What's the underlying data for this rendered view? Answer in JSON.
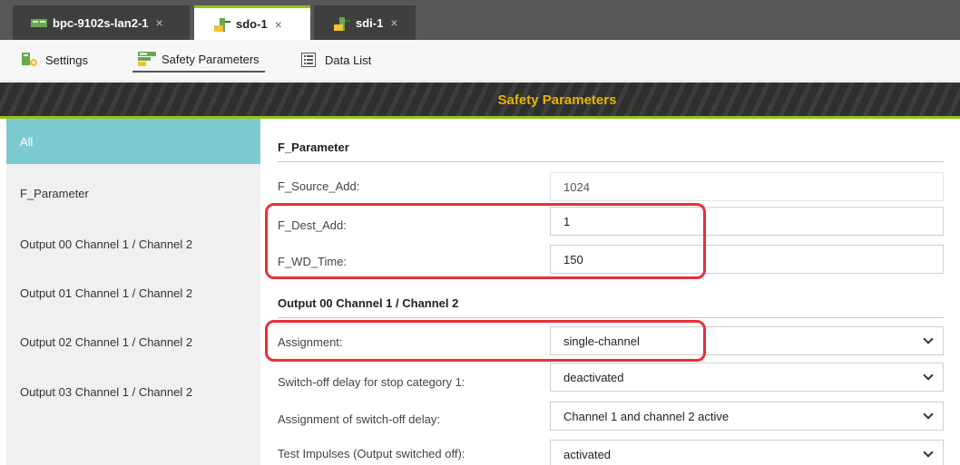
{
  "tabs": [
    {
      "label": "bpc-9102s-lan2-1",
      "close": "×",
      "icon": "device-icon",
      "active": false
    },
    {
      "label": "sdo-1",
      "close": "×",
      "icon": "module-icon",
      "active": true
    },
    {
      "label": "sdi-1",
      "close": "×",
      "icon": "module-icon",
      "active": false
    }
  ],
  "toolbar": {
    "settings_label": "Settings",
    "safety_label": "Safety Parameters",
    "datalist_label": "Data List"
  },
  "title": "Safety Parameters",
  "sidebar": {
    "items": [
      {
        "label": "All",
        "selected": true
      },
      {
        "label": "F_Parameter"
      },
      {
        "label": "Output 00 Channel 1 / Channel 2"
      },
      {
        "label": "Output 01 Channel 1 / Channel 2"
      },
      {
        "label": "Output 02 Channel 1 / Channel 2"
      },
      {
        "label": "Output 03 Channel 1 / Channel 2"
      }
    ]
  },
  "main": {
    "f_parameter": {
      "heading": "F_Parameter",
      "source_add": {
        "label": "F_Source_Add:",
        "value": "1024"
      },
      "dest_add": {
        "label": "F_Dest_Add:",
        "value": "1"
      },
      "wd_time": {
        "label": "F_WD_Time:",
        "value": "150"
      }
    },
    "output00": {
      "heading": "Output 00 Channel 1 / Channel 2",
      "assignment": {
        "label": "Assignment:",
        "value": "single-channel"
      },
      "switch_off_delay": {
        "label": "Switch-off delay for stop category 1:",
        "value": "deactivated"
      },
      "assignment_delay": {
        "label": "Assignment of switch-off delay:",
        "value": "Channel 1 and channel 2 active"
      },
      "test_impulses": {
        "label": "Test Impulses (Output switched off):",
        "value": "activated"
      }
    }
  },
  "colors": {
    "accent": "#93c21b",
    "title_text": "#e8b400",
    "sidebar_selected": "#7ccbd1",
    "highlight": "#e8303a"
  }
}
